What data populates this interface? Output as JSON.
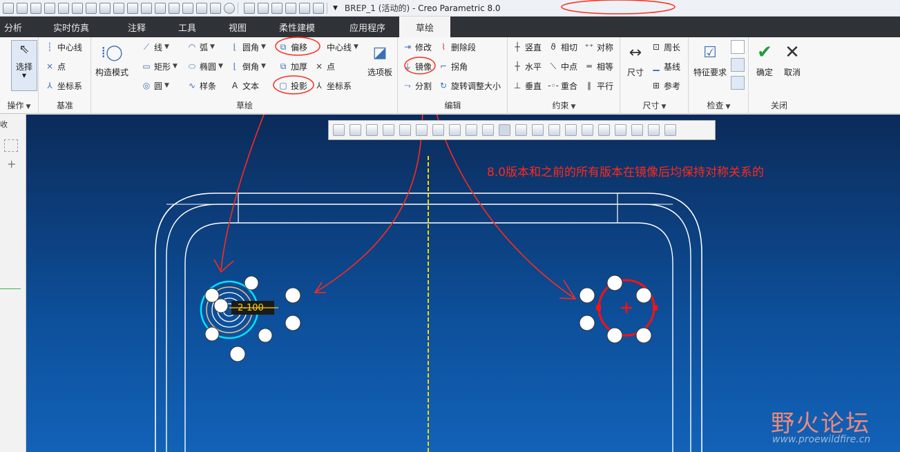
{
  "window": {
    "title_file": "BREP_1 (活动的)",
    "title_separator": " - ",
    "title_app": "Creo Parametric 8.0"
  },
  "quick_access": {
    "icons": [
      "new-icon",
      "open-icon",
      "save-icon",
      "save-as-icon",
      "print-icon",
      "regenerate-icon",
      "tools-icon",
      "render-icon",
      "datum-icon",
      "plane-icon",
      "axis-icon",
      "curve-icon",
      "point-icon",
      "sketch-icon",
      "display-icon",
      "view-icon",
      "shade-icon",
      "undo-icon",
      "redo-icon",
      "select-icon",
      "close-icon",
      "checkbox-icon",
      "window-icon"
    ]
  },
  "tabs": [
    "分析",
    "实时仿真",
    "注释",
    "工具",
    "视图",
    "柔性建模",
    "应用程序",
    "草绘"
  ],
  "ribbon": {
    "operations": {
      "select": "选择",
      "group_label": "操作"
    },
    "datum": {
      "centerline": "中心线",
      "point": "点",
      "coordsys": "坐标系",
      "group_label": "基准"
    },
    "sketch": {
      "construction_mode": "构造模式",
      "line": "线",
      "rectangle": "矩形",
      "circle": "圆",
      "arc": "弧",
      "ellipse": "椭圆",
      "spline": "样条",
      "fillet": "圆角",
      "chamfer": "倒角",
      "text": "文本",
      "offset": "偏移",
      "thicken": "加厚",
      "project": "投影",
      "centerline": "中心线",
      "point": "点",
      "coordsys": "坐标系",
      "palette": "选项板",
      "group_label": "草绘"
    },
    "edit": {
      "modify": "修改",
      "delete_segment": "删除段",
      "mirror": "镜像",
      "corner": "拐角",
      "divide": "分割",
      "rotate_resize": "旋转调整大小",
      "group_label": "编辑"
    },
    "constrain": {
      "vertical": "竖直",
      "tangent": "相切",
      "symmetric": "对称",
      "horizontal": "水平",
      "midpoint": "中点",
      "equal": "相等",
      "perpendicular": "垂直",
      "coincident": "重合",
      "parallel": "平行",
      "group_label": "约束"
    },
    "dimension": {
      "dimension": "尺寸",
      "perimeter": "周长",
      "baseline": "基线",
      "reference": "参考",
      "group_label": "尺寸"
    },
    "inspect": {
      "feature_requirements": "特征要求",
      "group_label": "检查"
    },
    "close": {
      "ok": "确定",
      "cancel": "取消",
      "group_label": "关闭"
    }
  },
  "left_panel": {
    "label": "收"
  },
  "graphics": {
    "toolbar_icons": [
      "refit-icon",
      "zoom-in-icon",
      "zoom-out-icon",
      "repaint-icon",
      "display-style-icon",
      "saved-orientation-icon",
      "view-manager-icon",
      "datum-display-icon",
      "annotation-display-icon",
      "spin-center-icon",
      "sketch-view-icon",
      "dimension-display-icon",
      "constraint-display-icon",
      "grid-display-icon",
      "vertex-display-icon",
      "sketch-settings-icon",
      "shading-icon",
      "shading-edges-icon",
      "appearance-icon",
      "section-icon",
      "disconnect-icon"
    ],
    "dimension_value": "2-100",
    "annotation": "8.0版本和之前的所有版本在镜像后均保持对称关系的",
    "watermark_title": "野火论坛",
    "watermark_url": "www.proewildfire.cn"
  },
  "colors": {
    "annotation_red": "#ff2a1a",
    "sketch_white": "#ffffff",
    "highlight_cyan": "#00e5ff",
    "selected_red": "#ff1010",
    "centerline_yellow": "#ffd700"
  }
}
